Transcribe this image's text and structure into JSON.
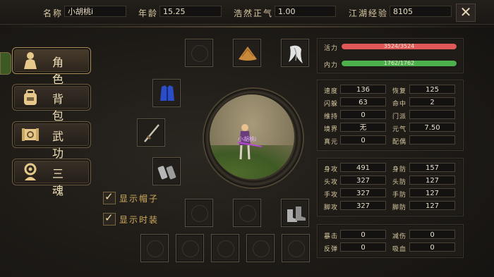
{
  "header": {
    "name_label": "名称",
    "name_value": "小胡桃i",
    "age_label": "年龄",
    "age_value": "15.25",
    "righteous_label": "浩然正气",
    "righteous_value": "1.00",
    "exp_label": "江湖经验",
    "exp_value": "8105",
    "close_glyph": "✕"
  },
  "menu": [
    {
      "label": "角色",
      "icon": "character-icon",
      "active": true
    },
    {
      "label": "背包",
      "icon": "backpack-icon",
      "active": false
    },
    {
      "label": "武功",
      "icon": "scroll-icon",
      "active": false
    },
    {
      "label": "三魂",
      "icon": "soul-icon",
      "active": false
    }
  ],
  "equipment": {
    "slots": [
      "empty",
      "straw-hat",
      "white-hair",
      "blue-robe",
      "sword",
      "wrist-guards",
      "empty",
      "empty",
      "boots",
      "empty",
      "empty",
      "empty",
      "empty",
      "empty"
    ]
  },
  "portrait": {
    "character_name": "小胡桃i"
  },
  "toggles": [
    {
      "label": "显示帽子",
      "checked": true
    },
    {
      "label": "显示时装",
      "checked": true
    }
  ],
  "vitals": {
    "hp_label": "活力",
    "hp_value": "3524/3524",
    "hp_fraction": 1.0,
    "hp_color": "#e05858",
    "mp_label": "内力",
    "mp_value": "1762/1762",
    "mp_fraction": 1.0,
    "mp_color": "#4cb04c"
  },
  "stats": {
    "speed_label": "速度",
    "speed": "136",
    "recover_label": "恢复",
    "recover": "125",
    "dodge_label": "闪躲",
    "dodge": "63",
    "hit_label": "命中",
    "hit": "2",
    "maintain_label": "维持",
    "maintain": "0",
    "sect_label": "门派",
    "sect": "",
    "realm_label": "境界",
    "realm": "无",
    "yuanqi_label": "元气",
    "yuanqi": "7.50",
    "zhenyuan_label": "真元",
    "zhenyuan": "0",
    "partner_label": "配偶",
    "partner": ""
  },
  "attack": {
    "body_atk_label": "身攻",
    "body_atk": "491",
    "body_def_label": "身防",
    "body_def": "157",
    "head_atk_label": "头攻",
    "head_atk": "327",
    "head_def_label": "头防",
    "head_def": "127",
    "hand_atk_label": "手攻",
    "hand_atk": "327",
    "hand_def_label": "手防",
    "hand_def": "127",
    "foot_atk_label": "脚攻",
    "foot_atk": "327",
    "foot_def_label": "脚防",
    "foot_def": "127"
  },
  "crit": {
    "crit_label": "暴击",
    "crit": "0",
    "reduce_label": "减伤",
    "reduce": "0",
    "reflect_label": "反弹",
    "reflect": "0",
    "drain_label": "吸血",
    "drain": "0"
  }
}
